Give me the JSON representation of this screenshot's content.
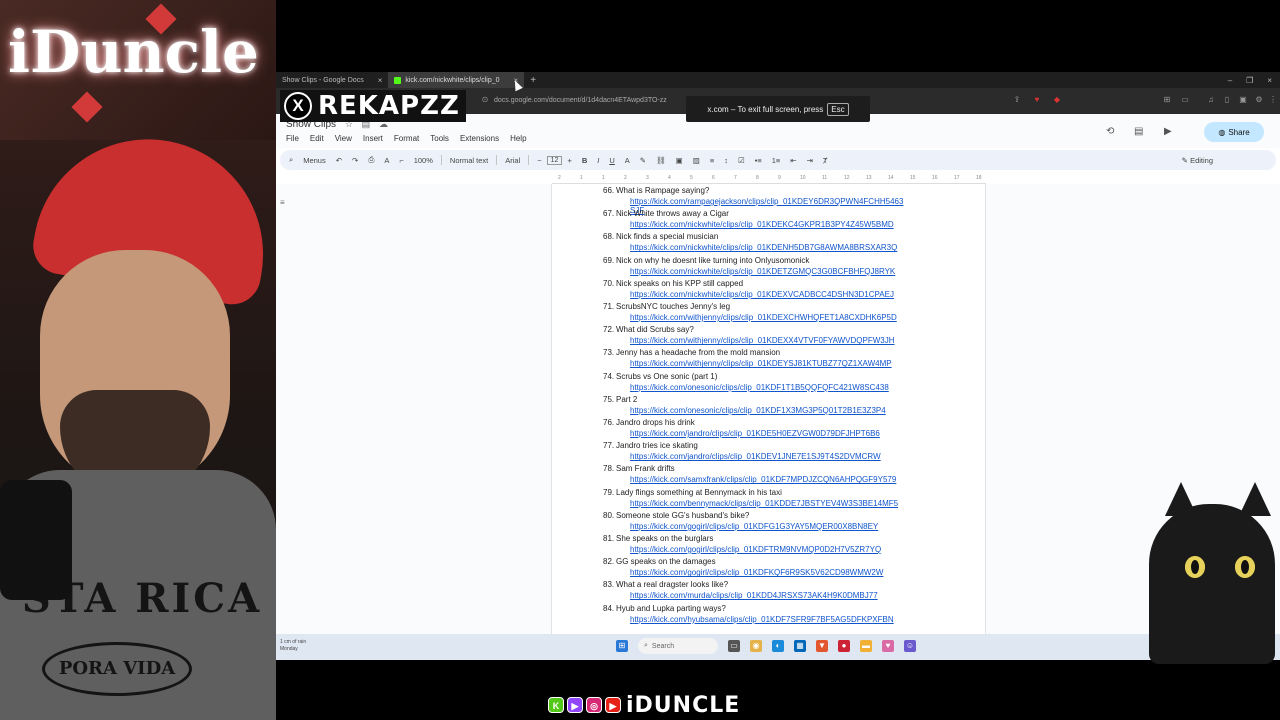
{
  "overlay": {
    "neon_sign": "iDuncle",
    "shirt_text": "STA RICA",
    "shirt_badge": "PORA VIDA",
    "x_logo": "X",
    "streamer_handle": "REKAPZZ",
    "brand_icons": [
      "K",
      "▶",
      "◎",
      "▶"
    ],
    "brand_name": "iDUNCLE"
  },
  "browser": {
    "tabs": [
      {
        "label": "Show Clips - Google Docs",
        "close": "×"
      },
      {
        "label": "kick.com/nickwhite/clips/clip_0",
        "close": "×"
      }
    ],
    "new_tab": "+",
    "window_controls": [
      "–",
      "❐",
      "×"
    ],
    "url": "docs.google.com/document/d/1d4dacn4ETAwpd3TO-zz",
    "fullscreen_toast": {
      "text": "x.com – To exit full screen, press",
      "key": "Esc"
    }
  },
  "docs": {
    "title": "Show Clips",
    "menu": [
      "File",
      "Edit",
      "View",
      "Insert",
      "Format",
      "Tools",
      "Extensions",
      "Help"
    ],
    "share_label": "Share",
    "toolbar": {
      "menus": "Menus",
      "zoom": "100%",
      "style": "Normal text",
      "font": "Arial",
      "font_size": "12",
      "editing": "Editing"
    },
    "ruler": [
      "2",
      "1",
      "1",
      "2",
      "3",
      "4",
      "5",
      "6",
      "7",
      "8",
      "9",
      "10",
      "11",
      "12",
      "13",
      "14",
      "15",
      "16",
      "17",
      "18"
    ],
    "entries": [
      {
        "num": "66.",
        "title": "What is Rampage saying?",
        "link": "https://kick.com/rampagejackson/clips/clip_01KDEY6DR3QPWN4FCHH5463",
        "extra": "SJF"
      },
      {
        "num": "67.",
        "title": "Nick White throws away a Cigar",
        "link": "https://kick.com/nickwhite/clips/clip_01KDEKC4GKPR1B3PY4Z45W5BMD"
      },
      {
        "num": "68.",
        "title": "Nick finds a special musician",
        "link": "https://kick.com/nickwhite/clips/clip_01KDENH5DB7G8AWMA8BRSXAR3Q"
      },
      {
        "num": "69.",
        "title": "Nick on why he doesnt like turning into Onlyusomonick",
        "link": "https://kick.com/nickwhite/clips/clip_01KDETZGMQC3G0BCFBHFQJ8RYK"
      },
      {
        "num": "70.",
        "title": "Nick speaks on his KPP still capped",
        "link": "https://kick.com/nickwhite/clips/clip_01KDEXVCADBCC4DSHN3D1CPAEJ"
      },
      {
        "num": "71.",
        "title": "ScrubsNYC touches Jenny's leg",
        "link": "https://kick.com/withjenny/clips/clip_01KDEXCHWHQFET1A8CXDHK6P5D"
      },
      {
        "num": "72.",
        "title": "What did Scrubs say?",
        "link": "https://kick.com/withjenny/clips/clip_01KDEXX4VTVF0FYAWVDQPFW3JH"
      },
      {
        "num": "73.",
        "title": "Jenny has a headache from the mold mansion",
        "link": "https://kick.com/withjenny/clips/clip_01KDEYSJ81KTUBZ77QZ1XAW4MP"
      },
      {
        "num": "74.",
        "title": "Scrubs vs One sonic (part 1)",
        "link": "https://kick.com/onesonic/clips/clip_01KDF1T1B5QQFQFC421W8SC438"
      },
      {
        "num": "75.",
        "title": "Part 2",
        "link": "https://kick.com/onesonic/clips/clip_01KDF1X3MG3P5Q01T2B1E3Z3P4"
      },
      {
        "num": "76.",
        "title": "Jandro drops his drink",
        "link": "https://kick.com/jandro/clips/clip_01KDE5H0EZVGW0D79DFJHPT6B6"
      },
      {
        "num": "77.",
        "title": "Jandro tries ice skating",
        "link": "https://kick.com/jandro/clips/clip_01KDEV1JNE7E1SJ9T4S2DVMCRW"
      },
      {
        "num": "78.",
        "title": "Sam Frank drifts",
        "link": "https://kick.com/samxfrank/clips/clip_01KDF7MPDJZCQN6AHPQGF9Y579"
      },
      {
        "num": "79.",
        "title": "Lady flings something at Bennymack in his taxi",
        "link": "https://kick.com/bennymack/clips/clip_01KDDE7JBSTYEV4W3S3BE14MF5"
      },
      {
        "num": "80.",
        "title": "Someone stole GG's husband's bike?",
        "link": "https://kick.com/gogirl/clips/clip_01KDFG1G3YAY5MQER00X8BN8EY"
      },
      {
        "num": "81.",
        "title": "She speaks on the burglars",
        "link": "https://kick.com/gogirl/clips/clip_01KDFTRM9NVMQP0D2H7V5ZR7YQ"
      },
      {
        "num": "82.",
        "title": "GG speaks on the damages",
        "link": "https://kick.com/gogirl/clips/clip_01KDFKQF6R9SK5V62CD98WMW2W"
      },
      {
        "num": "83.",
        "title": "What a real dragster looks like?",
        "link": "https://kick.com/murda/clips/clip_01KDD4JRSXS73AK4H9K0DMBJ77"
      },
      {
        "num": "84.",
        "title": "Hyub and Lupka parting ways?",
        "link": "https://kick.com/hyubsama/clips/clip_01KDF7SFR9F7BF5AG5DFKPXFBN"
      }
    ]
  },
  "status": {
    "left_line1": "1 cm of rain",
    "left_line2": "Monday",
    "search": "Search"
  }
}
